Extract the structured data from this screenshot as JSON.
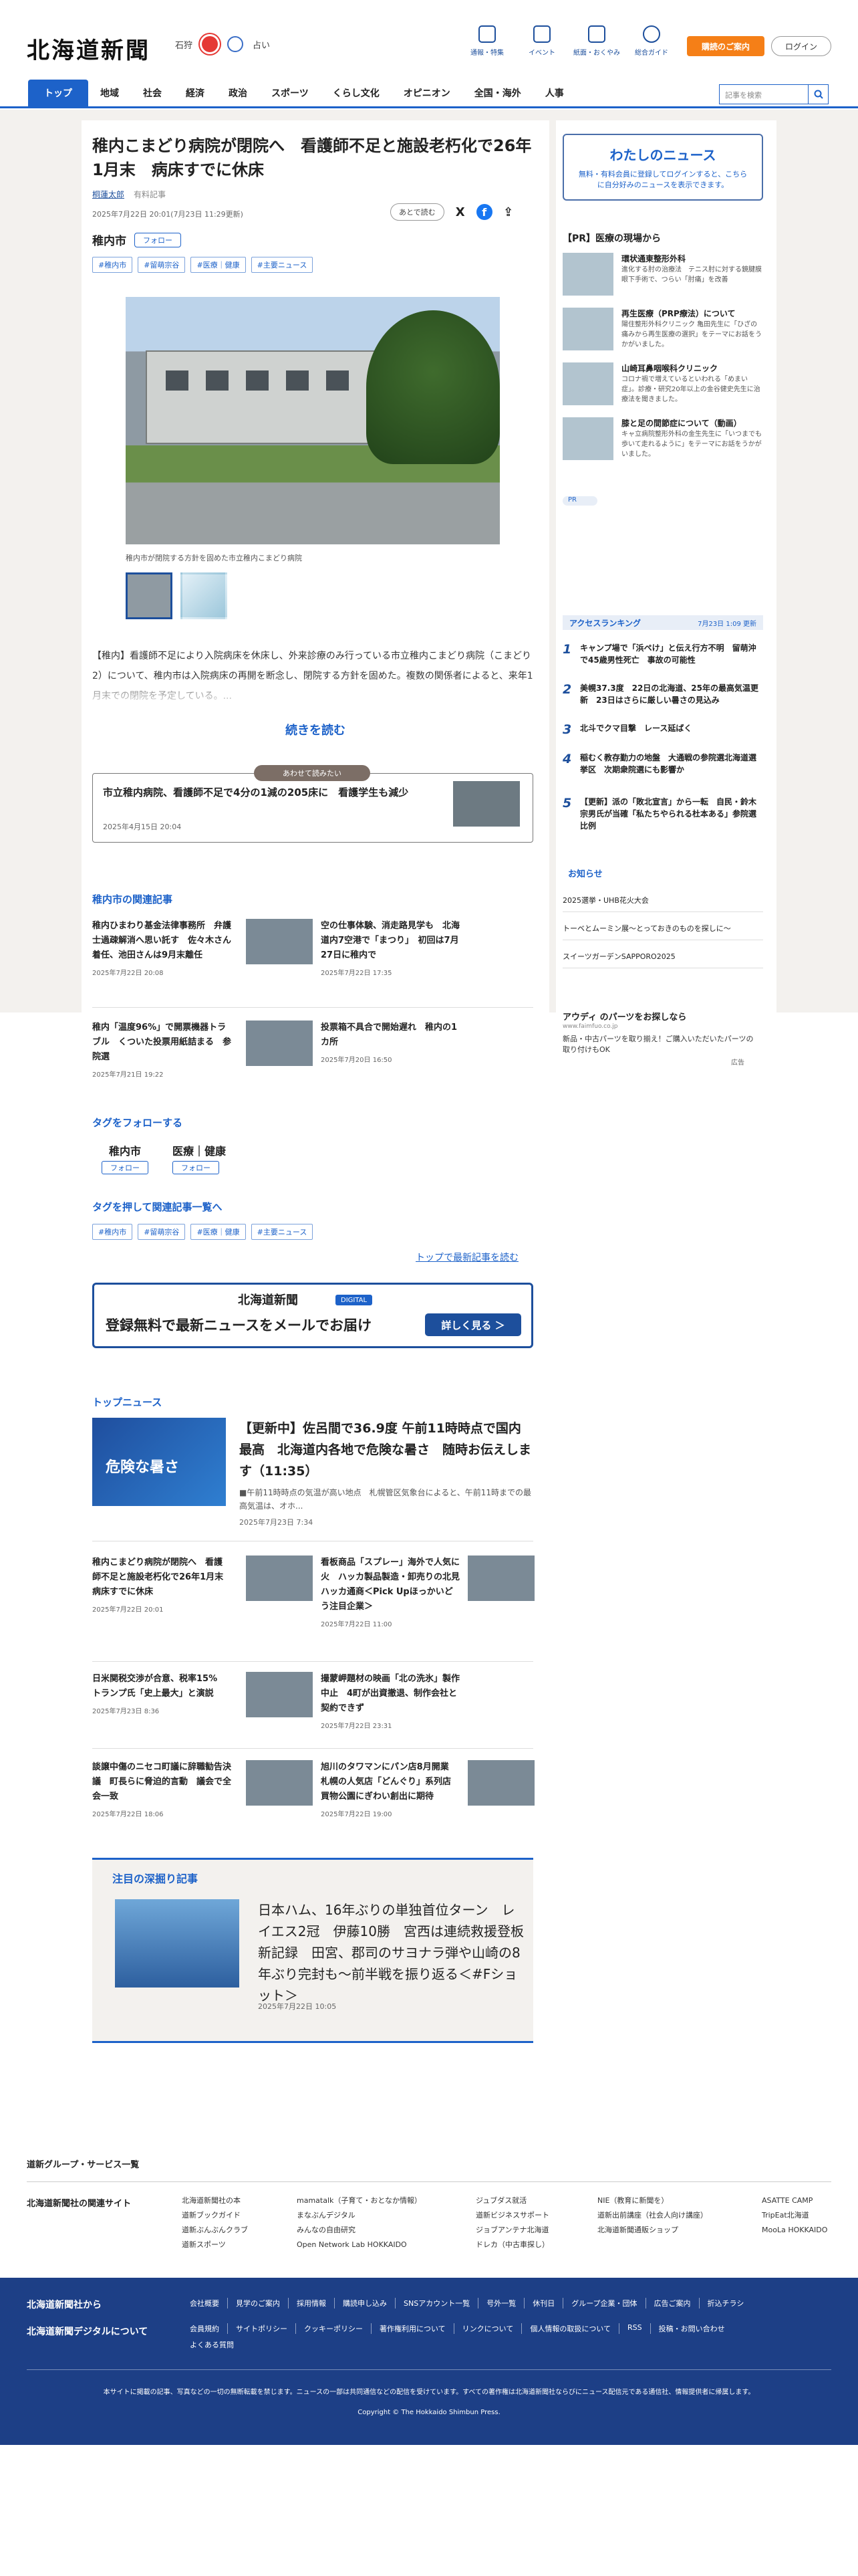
{
  "header": {
    "logo": "北海道新聞",
    "location": "石狩",
    "fortune": "占い",
    "icons": [
      "通報・特集",
      "イベント",
      "紙面・おくやみ",
      "総合ガイド"
    ],
    "subscribe": "購読のご案内",
    "login": "ログイン"
  },
  "nav": {
    "items": [
      "トップ",
      "地域",
      "社会",
      "経済",
      "政治",
      "スポーツ",
      "くらし文化",
      "オピニオン",
      "全国・海外",
      "人事"
    ],
    "search_placeholder": "記事を検索"
  },
  "article": {
    "title": "稚内こまどり病院が閉院へ　看護師不足と施設老朽化で26年1月末　病床すでに休床",
    "author": "桐蓮太郎",
    "author_badge": "有料記事",
    "dates": "2025年7月22日 20:01(7月23日 11:29更新)",
    "save_later": "あとで読む",
    "location": "稚内市",
    "follow": "フォロー",
    "tags": [
      "#稚内市",
      "#留萌宗谷",
      "#医療｜健康",
      "#主要ニュース"
    ],
    "photo_caption": "稚内市が閉院する方針を固めた市立稚内こまどり病院",
    "lead": "【稚内】看護師不足により入院病床を休床し、外来診療のみ行っている市立稚内こまどり病院（こまどり2）について、稚内市は入院病床の再開を断念し、閉院する方針を固めた。複数の関係者によると、来年1月末での閉院を予定している。...",
    "read_more": "続きを読む"
  },
  "related_pick": {
    "pill": "あわせて読みたい",
    "title": "市立稚内病院、看護師不足で4分の1減の205床に　看護学生も減少",
    "date": "2025年4月15日 20:04"
  },
  "city_related": {
    "heading": "稚内市の関連記事",
    "items": [
      {
        "title": "稚内ひまわり基金法律事務所　弁護士過疎解消へ思い託す　佐々木さん着任、池田さんは9月末離任",
        "date": "2025年7月22日 20:08"
      },
      {
        "title": "空の仕事体験、消走路見学も　北海道内7空港で「まつり」　初回は7月27日に稚内で",
        "date": "2025年7月22日 17:35"
      },
      {
        "title": "稚内「温度96%」で開票機器トラブル　くついた投票用紙詰まる　参院選",
        "date": "2025年7月21日 19:22"
      },
      {
        "title": "投票箱不具合で開始遅れ　稚内の1カ所",
        "date": "2025年7月20日 16:50"
      }
    ]
  },
  "follow_tags": {
    "heading": "タグをフォローする",
    "tags": [
      {
        "name": "稚内市",
        "btn": "フォロー"
      },
      {
        "name": "医療｜健康",
        "btn": "フォロー"
      }
    ],
    "list_heading": "タグを押して関連記事一覧へ",
    "chips": [
      "#稚内市",
      "#留萌宗谷",
      "#医療｜健康",
      "#主要ニュース"
    ],
    "latest_link": "トップで最新記事を読む"
  },
  "mail": {
    "logo": "北海道新聞",
    "digital": "DIGITAL",
    "text": "登録無料で最新ニュースをメールでお届け",
    "button": "詳しく見る ＞"
  },
  "top_news": {
    "heading": "トップニュース",
    "big": {
      "image_text": "危険な暑さ",
      "title": "【更新中】佐呂間で36.9度 午前11時時点で国内最高　北海道内各地で危険な暑さ　随時お伝えします（11:35）",
      "summary": "■午前11時時点の気温が高い地点　札幌管区気象台によると、午前11時までの最高気温は、オホ...",
      "date": "2025年7月23日 7:34"
    },
    "items": [
      {
        "title": "稚内こまどり病院が閉院へ　看護師不足と施設老朽化で26年1月末　病床すでに休床",
        "date": "2025年7月22日 20:01"
      },
      {
        "title": "看板商品「スプレー」海外で人気に火　ハッカ製品製造・卸売りの北見ハッカ通商＜Pick Upほっかいどう注目企業＞",
        "date": "2025年7月22日 11:00"
      },
      {
        "title": "日米関税交渉が合意、税率15%　トランプ氏「史上最大」と演説",
        "date": "2025年7月23日 8:36"
      },
      {
        "title": "撮蒙岬題材の映画「北の洗氷」製作中止　4町が出資撤退、制作会社と契約できず",
        "date": "2025年7月22日 23:31"
      },
      {
        "title": "談譲中傷のニセコ町議に辞職勧告決議　町長らに脅迫的言動　議会で全会一致",
        "date": "2025年7月22日 18:06"
      },
      {
        "title": "旭川のタワマンにパン店8月開業　札幌の人気店「どんぐり」系列店　買物公園にぎわい創出に期待",
        "date": "2025年7月22日 19:00"
      }
    ]
  },
  "featured": {
    "heading": "注目の深掘り記事",
    "title": "日本ハム、16年ぶりの単独首位ターン　レイエス2冠　伊藤10勝　宮西は連続救援登板新記録　田宮、郡司のサヨナラ弾や山崎の8年ぶり完封も～前半戦を振り返る＜#Fショット＞",
    "date": "2025年7月22日 10:05"
  },
  "sidebar": {
    "mynews_title": "わたしのニュース",
    "mynews_text": "無料・有料会員に登録してログインすると、こちらに自分好みのニュースを表示できます。",
    "pr_heading": "【PR】医療の現場から",
    "pr": [
      {
        "title": "環状通東整形外科",
        "text": "進化する肘の治療法　テニス肘に対する鏡腱膜眼下手術で、つらい「肘痛」を改善"
      },
      {
        "title": "再生医療（PRP療法）について",
        "text": "陽住整形外科クリニック 亀田先生に「ひざの痛みから再生医療の選択」をテーマにお話をうかがいました。"
      },
      {
        "title": "山崎耳鼻咽喉科クリニック",
        "text": "コロナ禍で増えているといわれる「めまい症」。診療・研究20年以上の金谷健史先生に治療法を聞きました。"
      },
      {
        "title": "膝と足の間節症について（動画）",
        "text": "キャ立病院整形外科の金生先生に「いつまでも歩いて走れるように」をテーマにお話をうかがいました。"
      }
    ],
    "pr_tag": "PR",
    "ranking_heading": "アクセスランキング",
    "ranking_updated": "7月23日 1:09 更新",
    "ranking": [
      "キャンプ場で「浜ペけ」と伝え行方不明　留萌沖で45歳男性死亡　事故の可能性",
      "美幌37.3度　22日の北海道、25年の最高気温更新　23日はさらに厳しい暑さの見込み",
      "北斗でクマ目撃　レース延ばく",
      "稲むく教存勤力の地盤　大通戦の参院選北海道選挙区　次期衆院選にも影響か",
      "【更新】派の「敗北宣言」から一転　自民・鈴木宗男氏が当確「私たちやられる杜本ある」参院選比例"
    ],
    "notice_heading": "お知らせ",
    "notices": [
      "2025選挙・UHB花火大会",
      "トーベとムーミン展～とっておきのものを探しに～",
      "スイーツガーデンSAPPORO2025"
    ],
    "ad_title": "アウディ のパーツをお探しなら",
    "ad_url": "www.faimfuo.co.jp",
    "ad_text": "新品・中古パーツを取り揃え！ご購入いただいたパーツの取り付けもOK",
    "ad_label": "広告"
  },
  "footer": {
    "group": "道新グループ・サービス一覧",
    "related": "北海道新聞社の関連サイト",
    "cols": [
      [
        "北海道新聞社の本",
        "道新ブックガイド",
        "道新ぶんぶんクラブ",
        "道新スポーツ"
      ],
      [
        "mamatalk（子育て・おとなか情報）",
        "まなぶんデジタル",
        "みんなの自由研究",
        "Open Network Lab HOKKAIDO"
      ],
      [
        "ジュブダス就活",
        "道新ビジネスサポート",
        "ジョブアンテナ北海道",
        "ドレカ（中古車探し）"
      ],
      [
        "NIE（教育に新聞を）",
        "道新出前講座（社会人向け講座）",
        "北海道新聞通販ショップ"
      ],
      [
        "ASATTE CAMP",
        "TripEat北海道",
        "MooLa HOKKAIDO"
      ]
    ],
    "company_heading": "北海道新聞社から",
    "company_links": [
      "会社概要",
      "見学のご案内",
      "採用情報",
      "購読申し込み",
      "SNSアカウント一覧",
      "号外一覧",
      "休刊日",
      "グループ企業・団体",
      "広告ご案内",
      "折込チラシ"
    ],
    "digital_heading": "北海道新聞デジタルについて",
    "digital_links": [
      "会員規約",
      "サイトポリシー",
      "クッキーポリシー",
      "著作権利用について",
      "リンクについて",
      "個人情報の取扱について",
      "RSS",
      "投稿・お問い合わせ"
    ],
    "digital_links2": [
      "よくある質問"
    ],
    "note": "本サイトに掲載の記事、写真などの一切の無断転載を禁じます。ニュースの一部は共同通信などの配信を受けています。すべての著作権は北海道新聞社ならびにニュース配信元である通信社、情報提供者に帰属します。",
    "copyright": "Copyright © The Hokkaido Shimbun Press."
  }
}
